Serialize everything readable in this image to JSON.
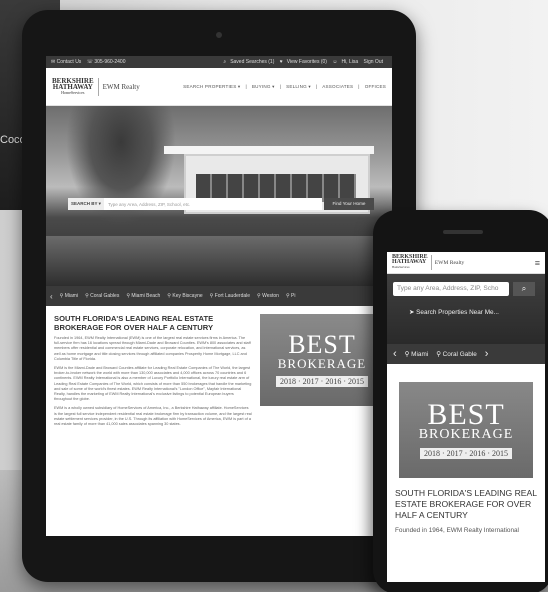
{
  "background": {
    "side_text": "Coco"
  },
  "tablet": {
    "topbar": {
      "contact": "✉ Contact Us",
      "phone": "☏ 305-960-2400",
      "saved_searches": "Saved Searches (1)",
      "favorites": "View Favorites (0)",
      "login": "Hi, Lisa",
      "signout": "Sign Out"
    },
    "logo": {
      "line1": "BERKSHIRE",
      "line2": "HATHAWAY",
      "line3": "HomeServices",
      "partner": "EWM Realty"
    },
    "nav": [
      "SEARCH PROPERTIES ▾",
      "BUYING ▾",
      "SELLING ▾",
      "ASSOCIATES",
      "OFFICES"
    ],
    "search": {
      "label": "SEARCH BY ▾",
      "placeholder": "Type any Area, Address, ZIP, School, etc.",
      "button": "Find Your Home"
    },
    "cities": [
      "Miami",
      "Coral Gables",
      "Miami Beach",
      "Key Biscayne",
      "Fort Lauderdale",
      "Weston",
      "Pi"
    ],
    "headline": "SOUTH FLORIDA'S LEADING REAL ESTATE BROKERAGE FOR OVER HALF A CENTURY",
    "paragraphs": [
      "Founded in 1964, EWM Realty International (EWM) is one of the largest real estate services firms in America. The full-service firm has 16 locations spread through Miami-Dade and Broward Counties. EWM's 800 associates and staff members offer residential and commercial real estate services, corporate relocation, and international services, as well as home mortgage and title closing services through affiliated companies Prosperity Home Mortgage, LLC and Columbia Title of Florida.",
      "EWM is the Miami-Dade and Broward Counties affiliate for Leading Real Estate Companies of The World, the largest broker-to-broker network the world with more than 130,000 associates and 4,000 offices across 70 countries and 6 continents. EWM Realty International is also a member of Luxury Portfolio International, the luxury real estate arm of Leading Real Estate Companies of The World, which consists of more than 550 brokerages that handle the marketing and sale of some of the world's finest estates. EWM Realty International's \"London Office\", Mayfair International Realty, handles the marketing of EWM Realty International's exclusive listings to potential European buyers throughout the globe.",
      "EWM is a wholly owned subsidiary of HomeServices of America, Inc., a Berkshire Hathaway affiliate. HomeServices is the largest full service independent residential real estate brokerage firm by transaction volume, and the largest real estate settlement services provider, in the U.S. Through its affiliation with HomeServices of America, EWM is part of a real estate family of more than 41,000 sales associates spanning 30 states."
    ],
    "award": {
      "line1": "BEST",
      "line2": "BROKERAGE",
      "years": "2018 · 2017 · 2016 · 2015"
    }
  },
  "phone": {
    "logo": {
      "line1": "BERKSHIRE",
      "line2": "HATHAWAY",
      "line3": "HomeServices",
      "partner": "EWM Realty"
    },
    "search_placeholder": "Type any Area, Address, ZIP, Scho",
    "near_me": "Search Properties Near Me...",
    "cities": [
      "Miami",
      "Coral Gable"
    ],
    "award": {
      "line1": "BEST",
      "line2": "BROKERAGE",
      "years": "2018 · 2017 · 2016 · 2015"
    },
    "headline": "SOUTH FLORIDA'S LEADING REAL ESTATE BROKERAGE FOR OVER HALF A CENTURY",
    "intro": "Founded in 1964, EWM Realty International"
  }
}
